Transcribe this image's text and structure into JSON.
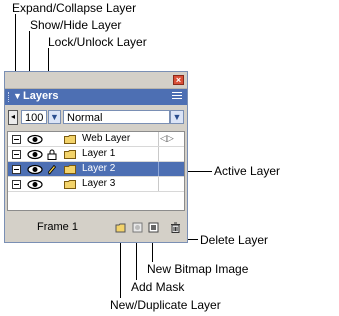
{
  "callouts": {
    "expand_collapse": "Expand/Collapse Layer",
    "show_hide": "Show/Hide Layer",
    "lock_unlock": "Lock/Unlock Layer",
    "active_layer": "Active Layer",
    "delete_layer": "Delete Layer",
    "new_bitmap": "New Bitmap Image",
    "add_mask": "Add Mask",
    "new_duplicate": "New/Duplicate Layer"
  },
  "panel": {
    "title": "Layers",
    "opacity": "100",
    "blend_mode": "Normal",
    "layers": [
      {
        "name": "Web Layer",
        "active": false,
        "locked": false,
        "pencil": false
      },
      {
        "name": "Layer 1",
        "active": false,
        "locked": false,
        "pencil": false
      },
      {
        "name": "Layer 2",
        "active": true,
        "locked": false,
        "pencil": true
      },
      {
        "name": "Layer 3",
        "active": false,
        "locked": false,
        "pencil": false
      }
    ],
    "frame_label": "Frame 1"
  },
  "colors": {
    "title_bar": "#4d6fb3",
    "close_button": "#d94f37",
    "active_row": "#4d6fb3",
    "panel_bg": "#d4d0c8"
  }
}
